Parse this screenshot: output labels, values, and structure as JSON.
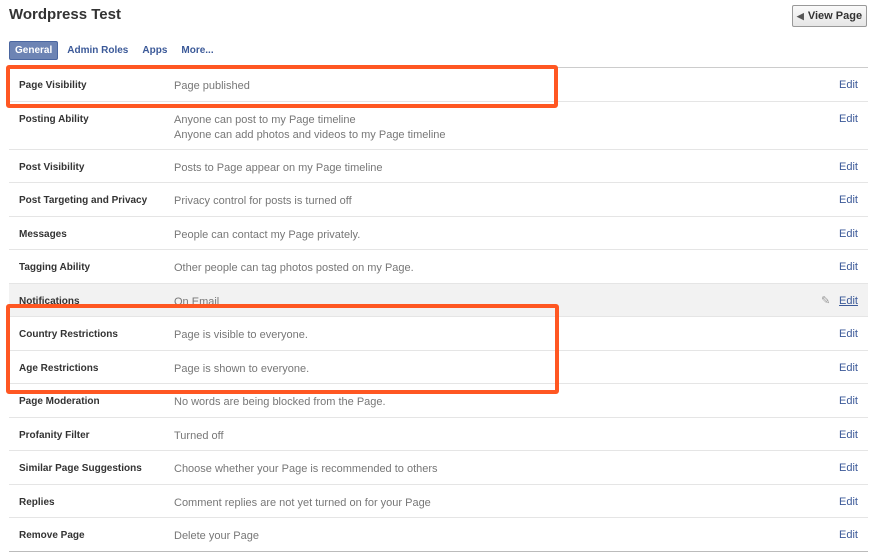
{
  "header": {
    "title": "Wordpress Test",
    "view_page_label": "View Page",
    "view_page_icon": "chevron-left-icon"
  },
  "tabs": [
    {
      "label": "General",
      "active": true
    },
    {
      "label": "Admin Roles",
      "active": false
    },
    {
      "label": "Apps",
      "active": false
    },
    {
      "label": "More...",
      "active": false
    }
  ],
  "settings": {
    "edit_label": "Edit",
    "rows": [
      {
        "label": "Page Visibility",
        "value": "Page published"
      },
      {
        "label": "Posting Ability",
        "value": "Anyone can post to my Page timeline",
        "value2": "Anyone can add photos and videos to my Page timeline"
      },
      {
        "label": "Post Visibility",
        "value": "Posts to Page appear on my Page timeline"
      },
      {
        "label": "Post Targeting and Privacy",
        "value": "Privacy control for posts is turned off"
      },
      {
        "label": "Messages",
        "value": "People can contact my Page privately."
      },
      {
        "label": "Tagging Ability",
        "value": "Other people can tag photos posted on my Page."
      },
      {
        "label": "Notifications",
        "value": "On Email",
        "hovered": true
      },
      {
        "label": "Country Restrictions",
        "value": "Page is visible to everyone."
      },
      {
        "label": "Age Restrictions",
        "value": "Page is shown to everyone."
      },
      {
        "label": "Page Moderation",
        "value": "No words are being blocked from the Page."
      },
      {
        "label": "Profanity Filter",
        "value": "Turned off"
      },
      {
        "label": "Similar Page Suggestions",
        "value": "Choose whether your Page is recommended to others"
      },
      {
        "label": "Replies",
        "value": "Comment replies are not yet turned on for your Page"
      },
      {
        "label": "Remove Page",
        "value": "Delete your Page"
      }
    ]
  },
  "annotation_color": "#ff5722"
}
